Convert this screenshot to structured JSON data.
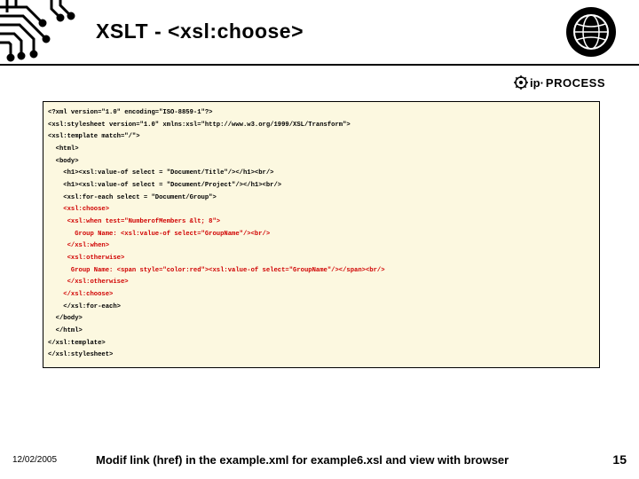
{
  "title": "XSLT - <xsl:choose>",
  "code": {
    "l0": "<?xml version=\"1.0\" encoding=\"ISO-8859-1\"?>",
    "l1": "<xsl:stylesheet version=\"1.0\" xmlns:xsl=\"http://www.w3.org/1999/XSL/Transform\">",
    "l2": "<xsl:template match=\"/\">",
    "l3": "  <html>",
    "l4": "  <body>",
    "l5": "    <h1><xsl:value-of select = \"Document/Title\"/></h1><br/>",
    "l6": "    <h1><xsl:value-of select = \"Document/Project\"/></h1><br/>",
    "l7": "    <xsl:for-each select = \"Document/Group\">",
    "l8": "    <xsl:choose>",
    "l9": "     <xsl:when test=\"NumberofMembers &lt; 8\">",
    "l10": "       Group Name: <xsl:value-of select=\"GroupName\"/><br/>",
    "l11": "     </xsl:when>",
    "l12": "     <xsl:otherwise>",
    "l13": "      Group Name: <span style=\"color:red\"><xsl:value-of select=\"GroupName\"/></span><br/>",
    "l14": "     </xsl:otherwise>",
    "l15": "    </xsl:choose>",
    "l16": "    </xsl:for-each>",
    "l17": "  </body>",
    "l18": "  </html>",
    "l19": "</xsl:template>",
    "l20": "</xsl:stylesheet>"
  },
  "footer": {
    "date": "12/02/2005",
    "text": "Modif link (href) in the example.xml for example6.xsl and view with browser",
    "page": "15"
  },
  "logo": {
    "ip": "ip·",
    "process": "PROCESS"
  }
}
